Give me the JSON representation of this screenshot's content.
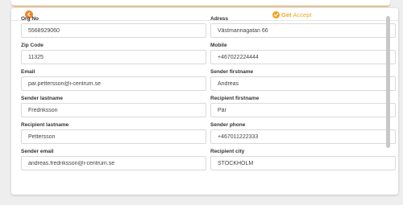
{
  "header": {
    "brand_get": "Get",
    "brand_accept": "Accept"
  },
  "form": {
    "fields": [
      {
        "label": "Org No",
        "value": "5568929060"
      },
      {
        "label": "Adress",
        "value": "Västmannagatan 66"
      },
      {
        "label": "Zip Code",
        "value": "11325"
      },
      {
        "label": "Mobile",
        "value": "+467022224444"
      },
      {
        "label": "Email",
        "value": "par.pettersson@i-centrum.se"
      },
      {
        "label": "Sender firstname",
        "value": "Andreas"
      },
      {
        "label": "Sender lastname",
        "value": "Fredriksson"
      },
      {
        "label": "Recipient firstname",
        "value": "Pär"
      },
      {
        "label": "Recipient lastname",
        "value": "Pettersson"
      },
      {
        "label": "Sender phone",
        "value": "+467011222333"
      },
      {
        "label": "Sender email",
        "value": "andreas.fredriksson@i-centrum.se"
      },
      {
        "label": "Recipient city",
        "value": "STOCKHOLM"
      }
    ]
  },
  "colors": {
    "accent": "#f58220",
    "brand": "#f5a623"
  }
}
